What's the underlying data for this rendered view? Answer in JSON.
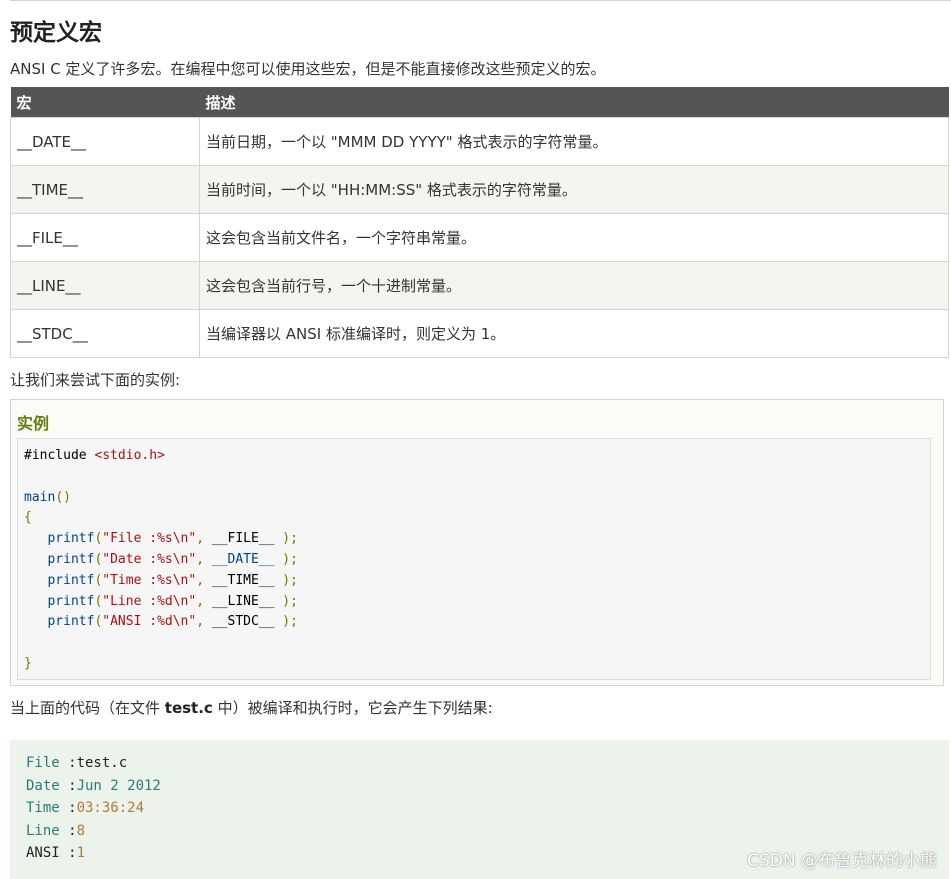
{
  "heading": "预定义宏",
  "intro": "ANSI C 定义了许多宏。在编程中您可以使用这些宏，但是不能直接修改这些预定义的宏。",
  "table": {
    "headers": [
      "宏",
      "描述"
    ],
    "rows": [
      {
        "macro": "__DATE__",
        "desc": "当前日期，一个以 \"MMM DD YYYY\" 格式表示的字符常量。"
      },
      {
        "macro": "__TIME__",
        "desc": "当前时间，一个以 \"HH:MM:SS\" 格式表示的字符常量。"
      },
      {
        "macro": "__FILE__",
        "desc": "这会包含当前文件名，一个字符串常量。"
      },
      {
        "macro": "__LINE__",
        "desc": "这会包含当前行号，一个十进制常量。"
      },
      {
        "macro": "__STDC__",
        "desc": "当编译器以 ANSI 标准编译时，则定义为 1。"
      }
    ]
  },
  "lead": "让我们来尝试下面的实例:",
  "example": {
    "title": "实例",
    "code": {
      "include_kw": "#include ",
      "include_file": "<stdio.h>",
      "main": "main",
      "lines": [
        {
          "fn": "printf",
          "str": "\"File :%s\\n\"",
          "macro": "__FILE__"
        },
        {
          "fn": "printf",
          "str": "\"Date :%s\\n\"",
          "macro": "__DATE__"
        },
        {
          "fn": "printf",
          "str": "\"Time :%s\\n\"",
          "macro": "__TIME__"
        },
        {
          "fn": "printf",
          "str": "\"Line :%d\\n\"",
          "macro": "__LINE__"
        },
        {
          "fn": "printf",
          "str": "\"ANSI :%d\\n\"",
          "macro": "__STDC__"
        }
      ]
    }
  },
  "note": {
    "before": "当上面的代码（在文件 ",
    "file": "test.c",
    "after": " 中）被编译和执行时，它会产生下列结果:"
  },
  "output": [
    {
      "key": "File",
      "value": "test.c"
    },
    {
      "key": "Date",
      "value": "Jun 2 2012"
    },
    {
      "key": "Time",
      "value": "03:36:24"
    },
    {
      "key": "Line",
      "value": "8"
    },
    {
      "key": "ANSI",
      "value": "1"
    }
  ],
  "watermark": "CSDN @布鲁克林的小熊"
}
